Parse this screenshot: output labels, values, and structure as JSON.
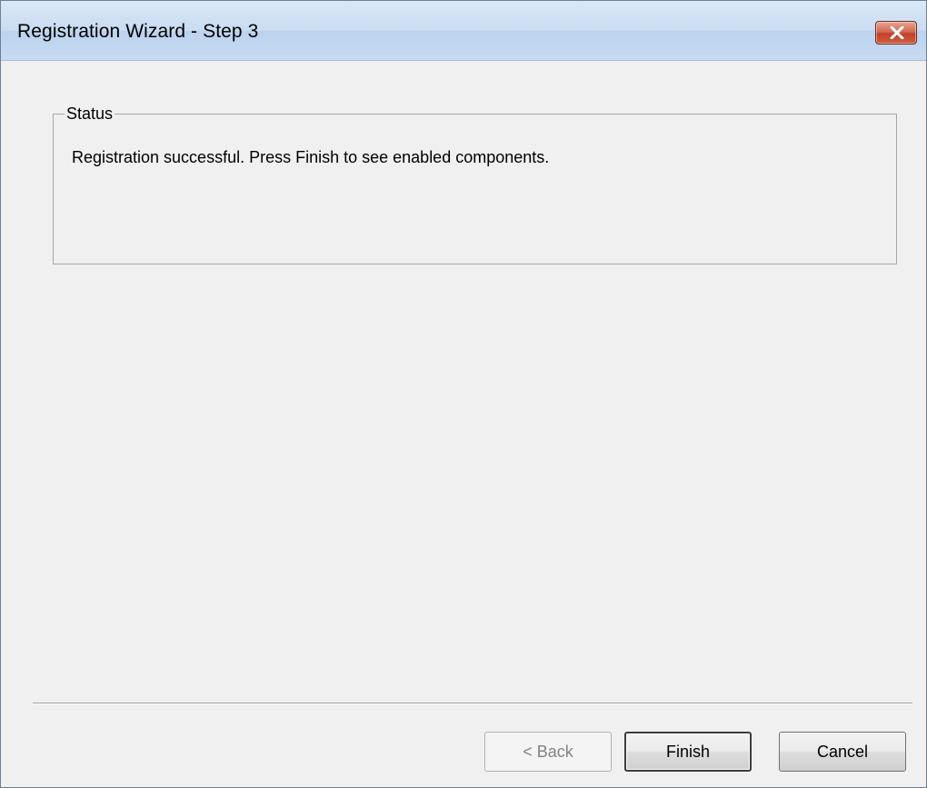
{
  "window": {
    "title": "Registration Wizard - Step 3",
    "close_icon": "close-icon"
  },
  "status": {
    "legend": "Status",
    "message": "Registration successful. Press Finish to see enabled components."
  },
  "buttons": {
    "back_label": "< Back",
    "finish_label": "Finish",
    "cancel_label": "Cancel",
    "back_enabled": false,
    "finish_default": true
  },
  "colors": {
    "background": "#f0f0f0",
    "close_button": "#c7432b",
    "titlebar": "#c9dcf2"
  }
}
